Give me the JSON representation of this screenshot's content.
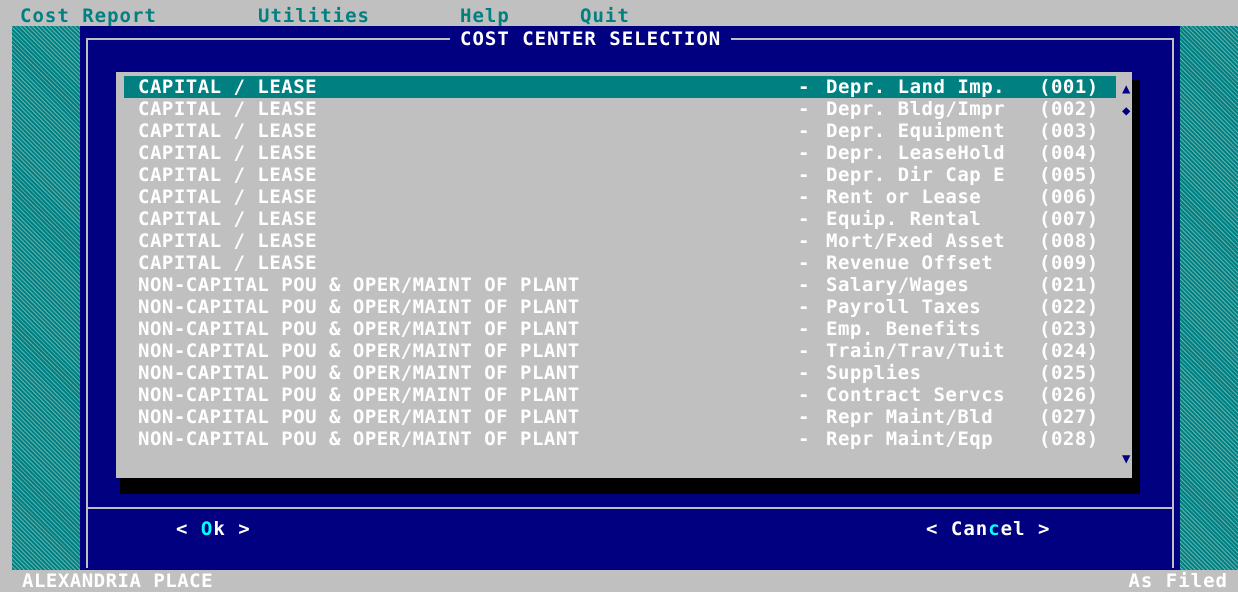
{
  "menu": {
    "items": [
      "Cost Report",
      "Utilities",
      "Help",
      "Quit"
    ]
  },
  "dialog": {
    "title": "COST CENTER SELECTION",
    "rows": [
      {
        "category": "CAPITAL / LEASE",
        "description": "Depr. Land Imp.",
        "code": "(001)",
        "selected": true
      },
      {
        "category": "CAPITAL / LEASE",
        "description": "Depr. Bldg/Impr",
        "code": "(002)",
        "selected": false
      },
      {
        "category": "CAPITAL / LEASE",
        "description": "Depr. Equipment",
        "code": "(003)",
        "selected": false
      },
      {
        "category": "CAPITAL / LEASE",
        "description": "Depr. LeaseHold",
        "code": "(004)",
        "selected": false
      },
      {
        "category": "CAPITAL / LEASE",
        "description": "Depr. Dir Cap E",
        "code": "(005)",
        "selected": false
      },
      {
        "category": "CAPITAL / LEASE",
        "description": "Rent or Lease",
        "code": "(006)",
        "selected": false
      },
      {
        "category": "CAPITAL / LEASE",
        "description": "Equip. Rental",
        "code": "(007)",
        "selected": false
      },
      {
        "category": "CAPITAL / LEASE",
        "description": "Mort/Fxed Asset",
        "code": "(008)",
        "selected": false
      },
      {
        "category": "CAPITAL / LEASE",
        "description": "Revenue Offset",
        "code": "(009)",
        "selected": false
      },
      {
        "category": "NON-CAPITAL POU & OPER/MAINT OF PLANT",
        "description": "Salary/Wages",
        "code": "(021)",
        "selected": false
      },
      {
        "category": "NON-CAPITAL POU & OPER/MAINT OF PLANT",
        "description": "Payroll Taxes",
        "code": "(022)",
        "selected": false
      },
      {
        "category": "NON-CAPITAL POU & OPER/MAINT OF PLANT",
        "description": "Emp. Benefits",
        "code": "(023)",
        "selected": false
      },
      {
        "category": "NON-CAPITAL POU & OPER/MAINT OF PLANT",
        "description": "Train/Trav/Tuit",
        "code": "(024)",
        "selected": false
      },
      {
        "category": "NON-CAPITAL POU & OPER/MAINT OF PLANT",
        "description": "Supplies",
        "code": "(025)",
        "selected": false
      },
      {
        "category": "NON-CAPITAL POU & OPER/MAINT OF PLANT",
        "description": "Contract Servcs",
        "code": "(026)",
        "selected": false
      },
      {
        "category": "NON-CAPITAL POU & OPER/MAINT OF PLANT",
        "description": "Repr Maint/Bld",
        "code": "(027)",
        "selected": false
      },
      {
        "category": "NON-CAPITAL POU & OPER/MAINT OF PLANT",
        "description": "Repr Maint/Eqp",
        "code": "(028)",
        "selected": false
      }
    ],
    "separator": "-",
    "buttons": {
      "ok": {
        "open": "< ",
        "hotkey": "O",
        "rest": "k",
        "close": " >"
      },
      "cancel": {
        "open": "< ",
        "pre": "Can",
        "hotkey": "c",
        "rest": "el",
        "close": " >"
      }
    },
    "scrollbar": {
      "up_glyph": "▲",
      "thumb_glyph": "◆",
      "down_glyph": "▼"
    }
  },
  "status": {
    "left": "ALEXANDRIA PLACE",
    "right": "As Filed"
  },
  "colors": {
    "desktop": "#008080",
    "dialog": "#000080",
    "list_bg": "#c0c0c0",
    "selection": "#008080",
    "text": "#ffffff",
    "hotkey": "#00ffff"
  }
}
